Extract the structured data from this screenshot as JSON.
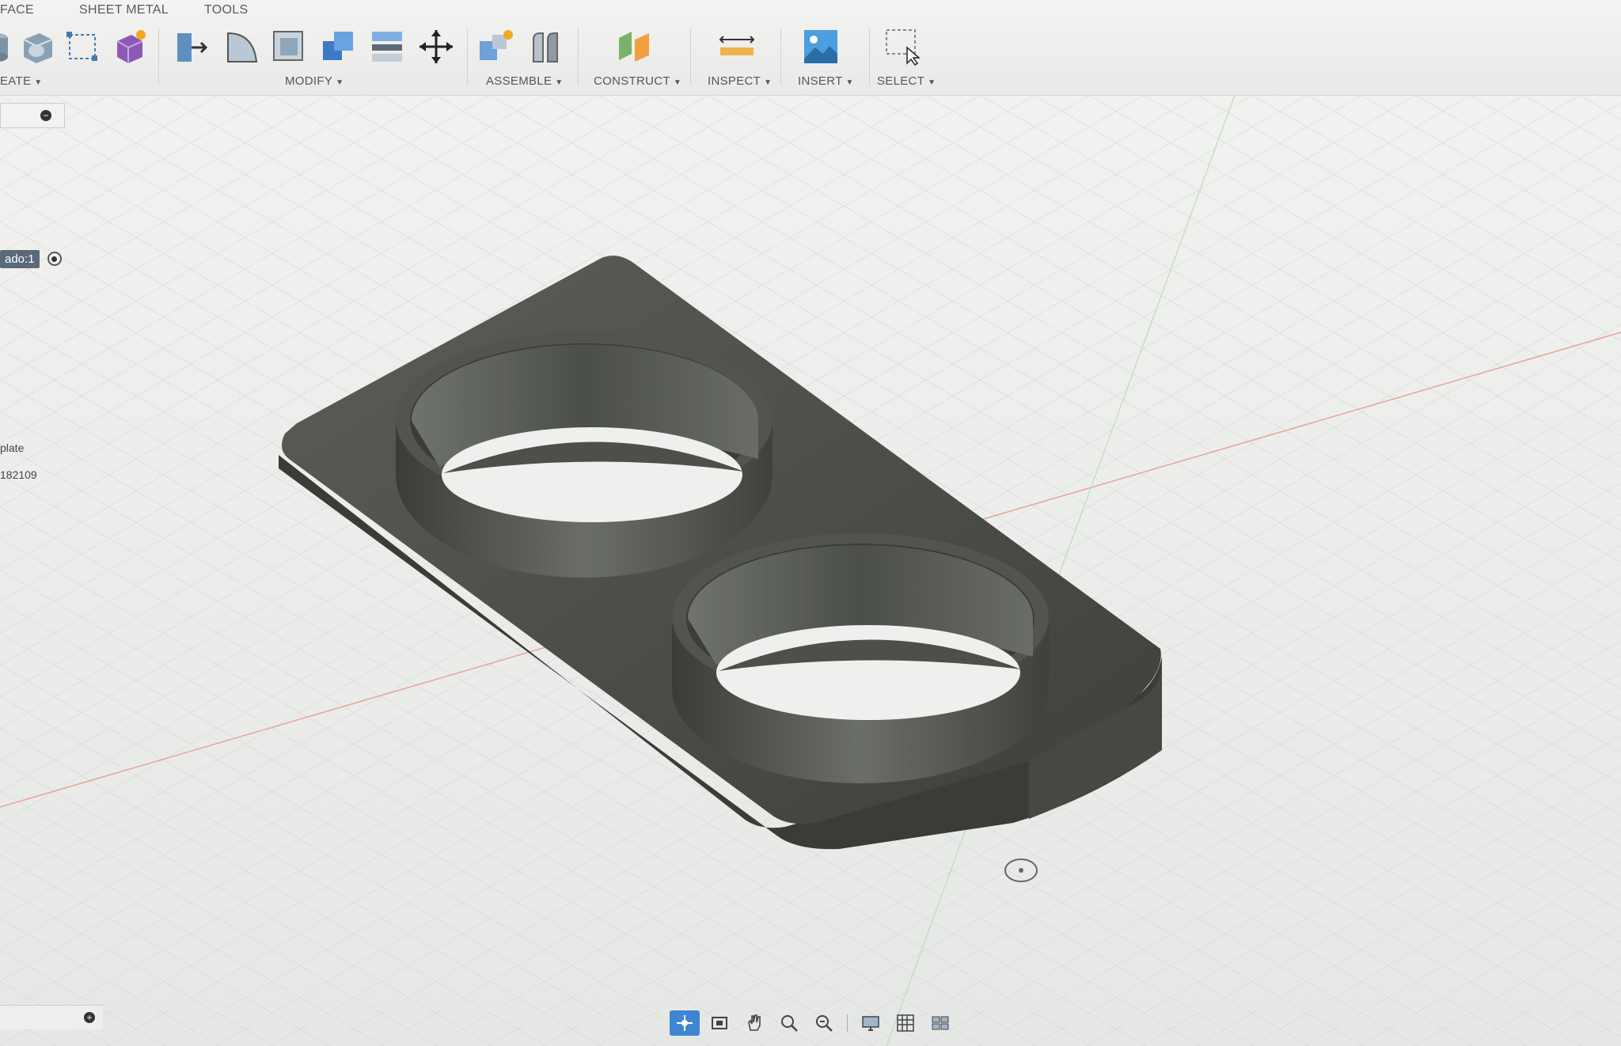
{
  "tabs": [
    "FACE",
    "SHEET METAL",
    "TOOLS"
  ],
  "groups": {
    "create": "EATE",
    "modify": "MODIFY",
    "assemble": "ASSEMBLE",
    "construct": "CONSTRUCT",
    "inspect": "INSPECT",
    "insert": "INSERT",
    "select": "SELECT"
  },
  "browser": {
    "component_label": "ado:1",
    "item_plate": "plate",
    "item_id": "182109"
  },
  "colors": {
    "accent": "#3e86d4",
    "model": "#4a4d48",
    "grid": "#d8dbd8"
  },
  "nav_icons": [
    "orbit-icon",
    "look-at-icon",
    "pan-icon",
    "zoom-icon",
    "fit-icon",
    "display-settings-icon",
    "grid-settings-icon",
    "viewports-icon"
  ]
}
